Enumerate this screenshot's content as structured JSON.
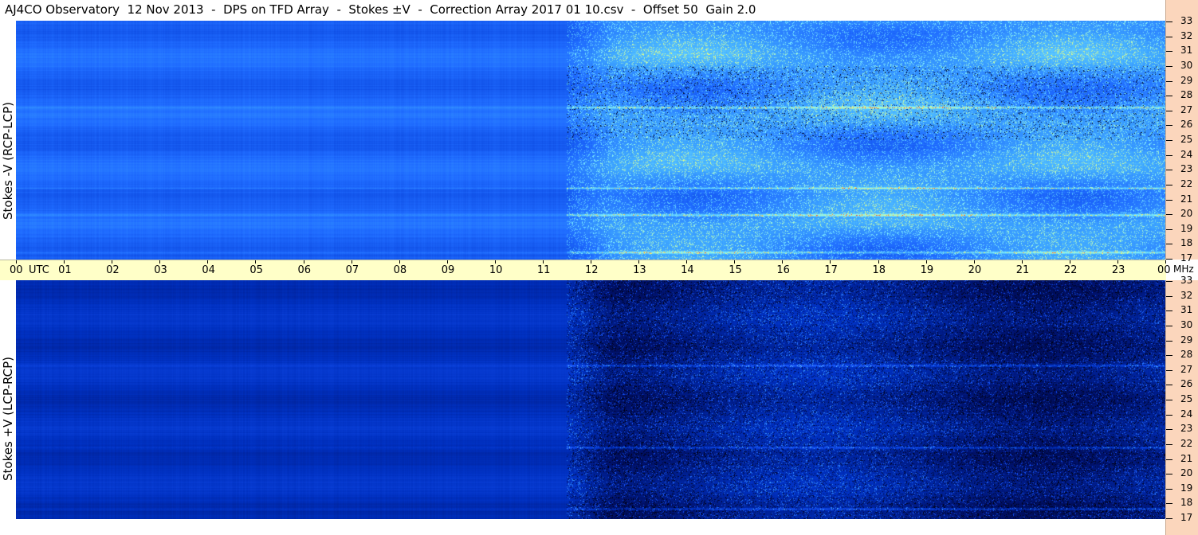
{
  "header": {
    "title": "AJ4CO Observatory  12 Nov 2013  -  DPS on TFD Array  -  Stokes ±V  -  Correction Array 2017 01 10.csv  -  Offset 50  Gain 2.0"
  },
  "chart_data": [
    {
      "type": "heatmap",
      "ylabel": "Stokes -V (RCP-LCP)",
      "xlabel": "UTC",
      "x_ticks": [
        "00",
        "01",
        "02",
        "03",
        "04",
        "05",
        "06",
        "07",
        "08",
        "09",
        "10",
        "11",
        "12",
        "13",
        "14",
        "15",
        "16",
        "17",
        "18",
        "19",
        "20",
        "21",
        "22",
        "23",
        "00"
      ],
      "y_unit": "MHz",
      "y_ticks": [
        17,
        18,
        19,
        20,
        21,
        22,
        23,
        24,
        25,
        26,
        27,
        28,
        29,
        30,
        31,
        32,
        33
      ],
      "ylim": [
        17,
        33
      ],
      "xlim_hours": [
        0,
        24
      ],
      "activity_onset_hour": 11.5,
      "bright_bands_mhz": [
        17.5,
        20,
        21.8,
        27.2
      ],
      "colormap": [
        "#000a2e",
        "#0033cc",
        "#1f6bff",
        "#3fa8ff",
        "#7ff0ff",
        "#ffff60",
        "#ff3020"
      ]
    },
    {
      "type": "heatmap",
      "ylabel": "Stokes +V (LCP-RCP)",
      "xlabel": "UTC",
      "x_ticks": [
        "00",
        "01",
        "02",
        "03",
        "04",
        "05",
        "06",
        "07",
        "08",
        "09",
        "10",
        "11",
        "12",
        "13",
        "14",
        "15",
        "16",
        "17",
        "18",
        "19",
        "20",
        "21",
        "22",
        "23",
        "00"
      ],
      "y_unit": "MHz",
      "y_ticks": [
        17,
        18,
        19,
        20,
        21,
        22,
        23,
        24,
        25,
        26,
        27,
        28,
        29,
        30,
        31,
        32,
        33
      ],
      "ylim": [
        17,
        33
      ],
      "xlim_hours": [
        0,
        24
      ],
      "activity_onset_hour": 11.5,
      "bright_bands_mhz": [
        17.7,
        21.8,
        27.3
      ],
      "colormap": [
        "#000010",
        "#001066",
        "#0030c0",
        "#1a58ff",
        "#40a8ff",
        "#a0ffff"
      ]
    }
  ],
  "axis": {
    "utc_label": "UTC",
    "mhz_label": "MHz"
  }
}
